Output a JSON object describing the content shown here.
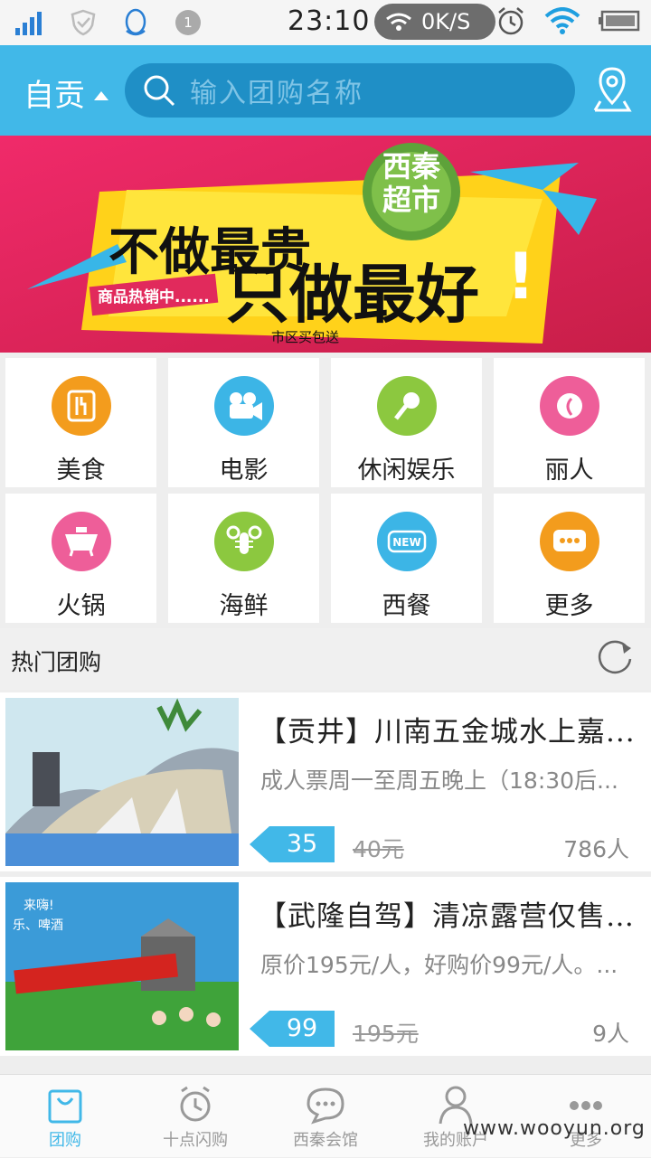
{
  "status_bar": {
    "time": "23:10",
    "net_speed": "0K/S",
    "notification_count": "1"
  },
  "header": {
    "city": "自贡",
    "search_placeholder": "输入团购名称"
  },
  "banner": {
    "tag": "商品热销中......",
    "headline_1": "不做最贵",
    "headline_2": "只做最好",
    "exclaim": "!",
    "badge_1": "西秦",
    "badge_2": "超市",
    "footnote": "市区买包送"
  },
  "categories": [
    {
      "label": "美食",
      "icon": "food-icon",
      "color": "#f39c1d"
    },
    {
      "label": "电影",
      "icon": "movie-camera-icon",
      "color": "#3cb5e6"
    },
    {
      "label": "休闲娱乐",
      "icon": "microphone-icon",
      "color": "#8cc83f"
    },
    {
      "label": "丽人",
      "icon": "beauty-icon",
      "color": "#ee5e99"
    },
    {
      "label": "火锅",
      "icon": "hotpot-icon",
      "color": "#ee5e99"
    },
    {
      "label": "海鲜",
      "icon": "lobster-icon",
      "color": "#8cc83f"
    },
    {
      "label": "西餐",
      "icon": "new-icon",
      "color": "#3cb5e6"
    },
    {
      "label": "更多",
      "icon": "more-icon",
      "color": "#f39c1d"
    }
  ],
  "hot": {
    "title": "热门团购"
  },
  "deals": [
    {
      "title": "【贡井】川南五金城水上嘉...",
      "desc": "成人票周一至周五晚上（18:30后...",
      "price": "35",
      "original": "40元",
      "count": "786人"
    },
    {
      "title": "【武隆自驾】清凉露营仅售9...",
      "desc": "原价195元/人，好购价99元/人。...",
      "price": "99",
      "original": "195元",
      "count": "9人"
    }
  ],
  "tabs": [
    {
      "label": "团购",
      "icon": "shopping-bag-icon"
    },
    {
      "label": "十点闪购",
      "icon": "alarm-clock-icon"
    },
    {
      "label": "西秦会馆",
      "icon": "chat-bubble-icon"
    },
    {
      "label": "我的账户",
      "icon": "user-icon"
    },
    {
      "label": "更多",
      "icon": "more-dots-icon"
    }
  ],
  "watermark": "www.wooyun.org",
  "colors": {
    "accent": "#41b8e8",
    "search_bg": "#1f8fc6",
    "banner_bg": "#e22b62"
  }
}
